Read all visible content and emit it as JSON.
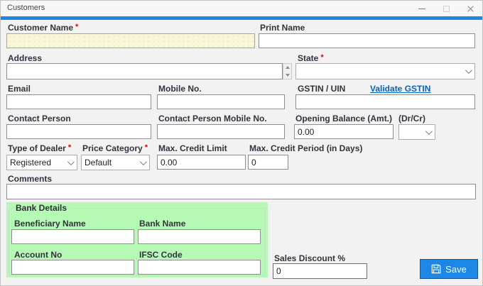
{
  "window": {
    "title": "Customers"
  },
  "required_marker": "*",
  "fields": {
    "customer_name": {
      "label": "Customer Name",
      "value": ""
    },
    "print_name": {
      "label": "Print Name",
      "value": ""
    },
    "address": {
      "label": "Address",
      "value": ""
    },
    "state": {
      "label": "State",
      "value": ""
    },
    "email": {
      "label": "Email",
      "value": ""
    },
    "mobile_no": {
      "label": "Mobile No.",
      "value": ""
    },
    "gstin": {
      "label": "GSTIN / UIN",
      "value": ""
    },
    "validate_gstin_link": "Validate GSTIN",
    "contact_person": {
      "label": "Contact Person",
      "value": ""
    },
    "contact_person_mobile": {
      "label": "Contact Person Mobile No.",
      "value": ""
    },
    "opening_balance": {
      "label": "Opening Balance (Amt.)",
      "value": "0.00"
    },
    "dr_cr": {
      "label": "(Dr/Cr)",
      "value": ""
    },
    "type_of_dealer": {
      "label": "Type of Dealer",
      "value": "Registered"
    },
    "price_category": {
      "label": "Price Category",
      "value": "Default"
    },
    "max_credit_limit": {
      "label": "Max. Credit Limit",
      "value": "0.00"
    },
    "max_credit_period": {
      "label": "Max. Credit Period (in Days)",
      "value": "0"
    },
    "comments": {
      "label": "Comments",
      "value": ""
    },
    "sales_discount": {
      "label": "Sales Discount %",
      "value": "0"
    }
  },
  "bank_details": {
    "title": "Bank Details",
    "beneficiary_name": {
      "label": "Beneficiary Name",
      "value": ""
    },
    "bank_name": {
      "label": "Bank Name",
      "value": ""
    },
    "account_no": {
      "label": "Account No",
      "value": ""
    },
    "ifsc_code": {
      "label": "IFSC Code",
      "value": ""
    }
  },
  "buttons": {
    "save": "Save"
  },
  "colors": {
    "accent_blue": "#1e87e5",
    "required_red": "#e40000",
    "highlight_yellow": "#f8f8d8",
    "bank_green": "#b5f9b5",
    "link_blue": "#0563c1",
    "save_blue": "#1e87e5"
  }
}
